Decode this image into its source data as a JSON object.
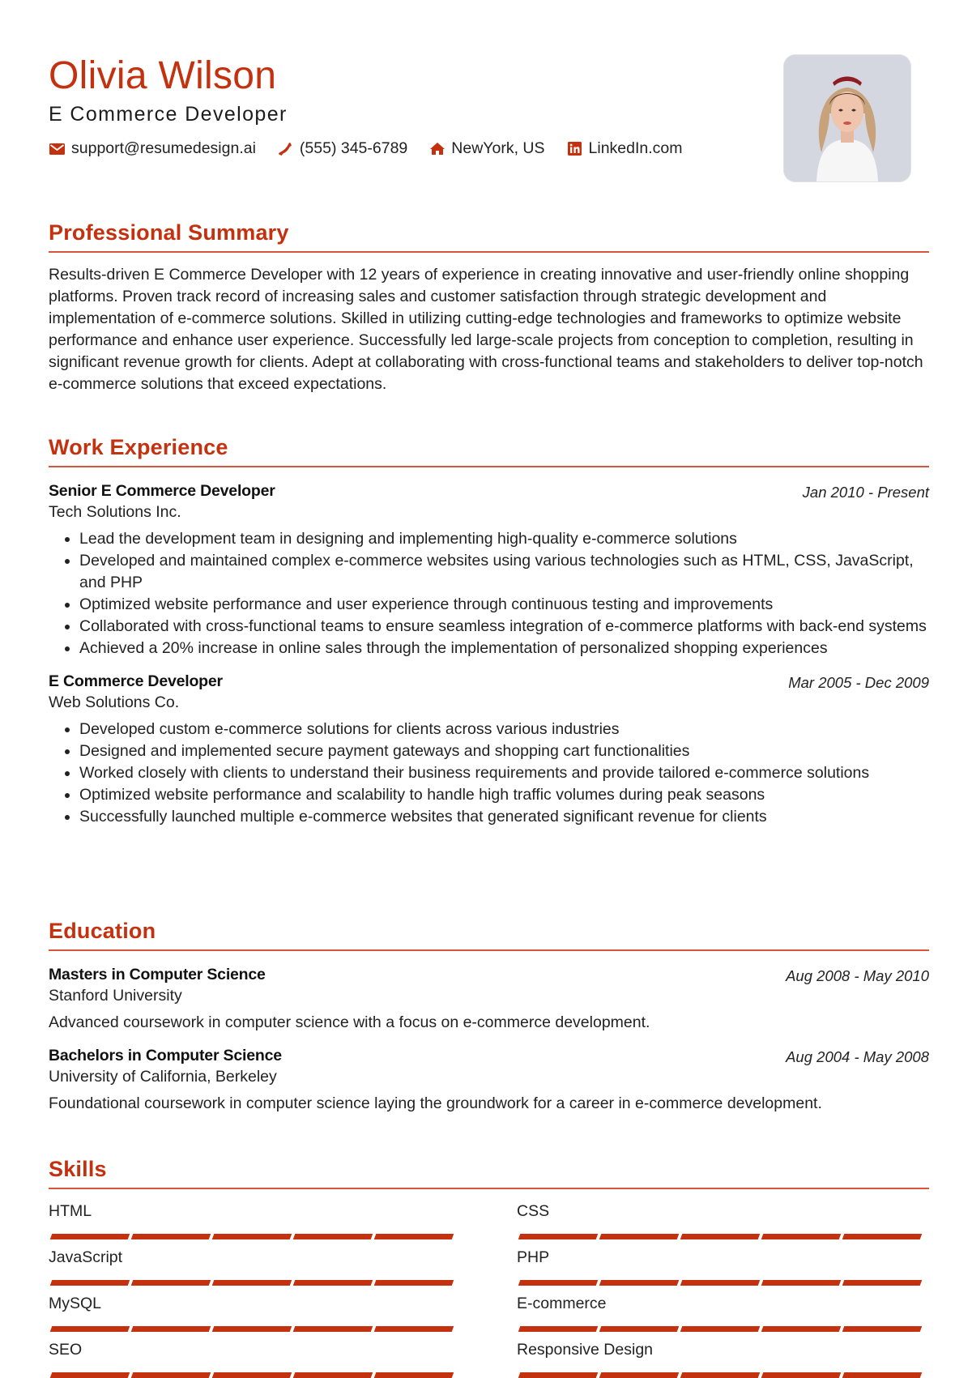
{
  "header": {
    "name": "Olivia Wilson",
    "title": "E Commerce Developer",
    "accent_color": "#c4310f",
    "contacts": [
      {
        "icon": "envelope-icon",
        "text": "support@resumedesign.ai"
      },
      {
        "icon": "phone-icon",
        "text": "(555) 345-6789"
      },
      {
        "icon": "home-icon",
        "text": "NewYork, US"
      },
      {
        "icon": "linkedin-icon",
        "text": "LinkedIn.com"
      }
    ],
    "photo_alt": "Profile photo"
  },
  "summary": {
    "heading": "Professional Summary",
    "text": "Results-driven E Commerce Developer with 12 years of experience in creating innovative and user-friendly online shopping platforms. Proven track record of increasing sales and customer satisfaction through strategic development and implementation of e-commerce solutions. Skilled in utilizing cutting-edge technologies and frameworks to optimize website performance and enhance user experience. Successfully led large-scale projects from conception to completion, resulting in significant revenue growth for clients. Adept at collaborating with cross-functional teams and stakeholders to deliver top-notch e-commerce solutions that exceed expectations."
  },
  "experience": {
    "heading": "Work Experience",
    "jobs": [
      {
        "title": "Senior E Commerce Developer",
        "company": "Tech Solutions Inc.",
        "dates": "Jan 2010 - Present",
        "bullets": [
          "Lead the development team in designing and implementing high-quality e-commerce solutions",
          "Developed and maintained complex e-commerce websites using various technologies such as HTML, CSS, JavaScript, and PHP",
          "Optimized website performance and user experience through continuous testing and improvements",
          "Collaborated with cross-functional teams to ensure seamless integration of e-commerce platforms with back-end systems",
          "Achieved a 20% increase in online sales through the implementation of personalized shopping experiences"
        ]
      },
      {
        "title": "E Commerce Developer",
        "company": "Web Solutions Co.",
        "dates": "Mar 2005 - Dec 2009",
        "bullets": [
          "Developed custom e-commerce solutions for clients across various industries",
          "Designed and implemented secure payment gateways and shopping cart functionalities",
          "Worked closely with clients to understand their business requirements and provide tailored e-commerce solutions",
          "Optimized website performance and scalability to handle high traffic volumes during peak seasons",
          "Successfully launched multiple e-commerce websites that generated significant revenue for clients"
        ]
      }
    ]
  },
  "education": {
    "heading": "Education",
    "items": [
      {
        "degree": "Masters in Computer Science",
        "school": "Stanford University",
        "dates": "Aug 2008 - May 2010",
        "description": "Advanced coursework in computer science with a focus on e-commerce development."
      },
      {
        "degree": "Bachelors in Computer Science",
        "school": "University of California, Berkeley",
        "dates": "Aug 2004 - May 2008",
        "description": "Foundational coursework in computer science laying the groundwork for a career in e-commerce development."
      }
    ]
  },
  "skills": {
    "heading": "Skills",
    "max_level": 5,
    "items": [
      {
        "name": "HTML",
        "level": 5
      },
      {
        "name": "CSS",
        "level": 5
      },
      {
        "name": "JavaScript",
        "level": 5
      },
      {
        "name": "PHP",
        "level": 5
      },
      {
        "name": "MySQL",
        "level": 5
      },
      {
        "name": "E-commerce",
        "level": 5
      },
      {
        "name": "SEO",
        "level": 5
      },
      {
        "name": "Responsive Design",
        "level": 5
      }
    ]
  }
}
